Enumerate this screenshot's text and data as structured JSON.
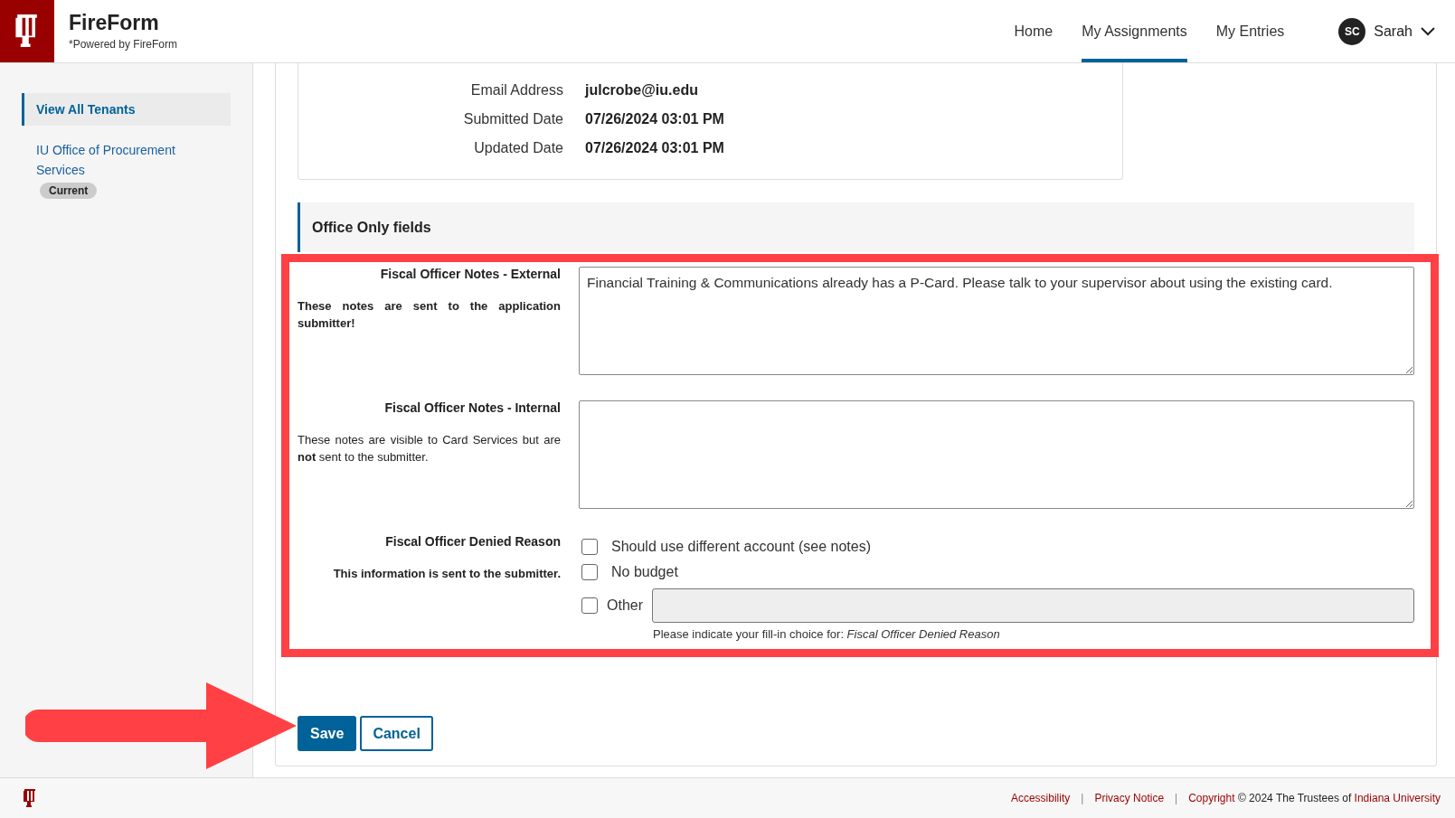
{
  "header": {
    "brand": "FireForm",
    "tagline": "*Powered by FireForm",
    "nav": [
      {
        "label": "Home",
        "selected": false
      },
      {
        "label": "My Assignments",
        "selected": true
      },
      {
        "label": "My Entries",
        "selected": false
      }
    ],
    "user": {
      "initials": "SC",
      "name": "Sarah"
    }
  },
  "sidebar": {
    "items": [
      {
        "label": "View All Tenants",
        "selected": true
      }
    ],
    "tenant": {
      "label": "IU Office of Procurement Services",
      "badge": "Current"
    }
  },
  "details": [
    {
      "label": "Email Address",
      "value": "julcrobe@iu.edu"
    },
    {
      "label": "Submitted Date",
      "value": "07/26/2024 03:01 PM"
    },
    {
      "label": "Updated Date",
      "value": "07/26/2024 03:01 PM"
    }
  ],
  "section": {
    "title": "Office Only fields"
  },
  "fields": [
    {
      "kind": "textarea",
      "label": "Fiscal Officer Notes - External",
      "help": "These notes are sent to the application submitter!",
      "help_bold": true,
      "value": "Financial Training & Communications already has a P-Card. Please talk to your supervisor about using the existing card."
    },
    {
      "kind": "textarea",
      "label": "Fiscal Officer Notes - Internal",
      "help": "These notes are visible to Card Services but are **not** sent to the submitter.",
      "help_bold": false
    },
    {
      "kind": "checkboxes",
      "label": "Fiscal Officer Denied Reason",
      "help": "This information is sent to the submitter.",
      "help_bold": true,
      "options": [
        {
          "label": "Should use different account (see notes)",
          "checked": false,
          "kind": "plain"
        },
        {
          "label": "No budget",
          "checked": false,
          "kind": "plain"
        },
        {
          "label": "Other",
          "checked": false,
          "kind": "fill-in"
        }
      ],
      "fill_in_hint": "Please indicate your fill-in choice for: *Fiscal Officer Denied Reason*"
    }
  ],
  "buttons": [
    {
      "label": "Save",
      "kind": "primary"
    },
    {
      "label": "Cancel",
      "kind": "secondary"
    }
  ],
  "footer": {
    "links": [
      "Accessibility",
      "Privacy Notice"
    ],
    "separator": "|",
    "copyright": [
      {
        "text": "Copyright",
        "kind": "link"
      },
      {
        "text": "© 2024 The Trustees of",
        "kind": "text"
      },
      {
        "text": "Indiana University",
        "kind": "link"
      }
    ]
  }
}
